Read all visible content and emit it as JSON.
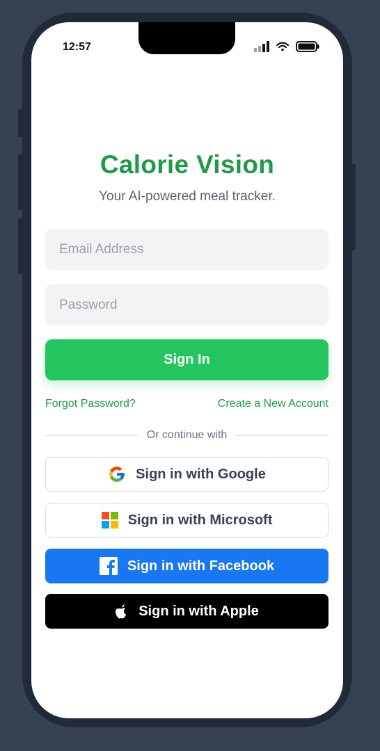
{
  "status_bar": {
    "time": "12:57",
    "icons": [
      "signal-icon",
      "wifi-icon",
      "battery-icon"
    ]
  },
  "header": {
    "title": "Calorie Vision",
    "subtitle": "Your AI-powered meal tracker."
  },
  "form": {
    "email_placeholder": "Email Address",
    "email_value": "",
    "password_placeholder": "Password",
    "password_value": "",
    "signin_label": "Sign In"
  },
  "links": {
    "forgot": "Forgot Password?",
    "create": "Create a New Account"
  },
  "divider_text": "Or continue with",
  "social": {
    "google": "Sign in with Google",
    "microsoft": "Sign in with Microsoft",
    "facebook": "Sign in with Facebook",
    "apple": "Sign in with Apple"
  },
  "colors": {
    "brand_green": "#1f9b48",
    "button_green": "#22c55e",
    "facebook_blue": "#1877f2",
    "apple_black": "#000000",
    "background": "#364152"
  }
}
